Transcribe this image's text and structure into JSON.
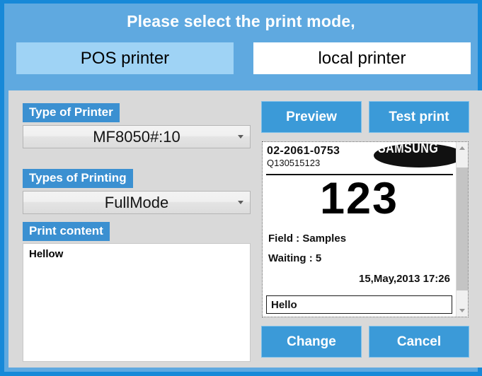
{
  "window": {
    "title": "Please select the print mode,",
    "accent_color": "#1789d8",
    "header_color": "#5fa9e0",
    "panel_color": "#d9d9d9"
  },
  "mode_tabs": [
    {
      "label": "POS printer",
      "selected": true,
      "background": "#9fd3f5"
    },
    {
      "label": "local printer",
      "selected": false,
      "background": "#ffffff"
    }
  ],
  "form": {
    "printer_type": {
      "label": "Type of Printer",
      "value": "MF8050#:10"
    },
    "printing_type": {
      "label": "Types of Printing",
      "value": "FullMode"
    },
    "print_content": {
      "label": "Print content",
      "value": "Hellow"
    }
  },
  "actions": {
    "preview": "Preview",
    "test_print": "Test print",
    "change": "Change",
    "cancel": "Cancel"
  },
  "preview": {
    "phone": "02-2061-0753",
    "code": "Q130515123",
    "brand": "SAMSUNG",
    "number": "123",
    "field_line": "Field : Samples",
    "waiting_line": "Waiting : 5",
    "datetime": "15,May,2013  17:26",
    "input_value": "Hello"
  }
}
